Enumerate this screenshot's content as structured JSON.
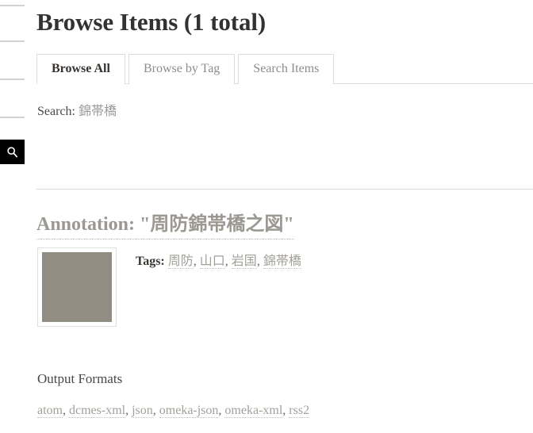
{
  "sidebar": {
    "nav_placeholder_count": 4,
    "search_button": {
      "icon": "search-icon",
      "label": "Search",
      "background": "#000000"
    }
  },
  "page": {
    "title": "Browse Items (1 total)"
  },
  "tabs": [
    {
      "label": "Browse All",
      "active": true
    },
    {
      "label": "Browse by Tag",
      "active": false
    },
    {
      "label": "Search Items",
      "active": false
    }
  ],
  "search_summary": {
    "label": "Search:",
    "query": "錦帯橋"
  },
  "record": {
    "heading": "Annotation: \"周防錦帯橋之図\"",
    "thumbnail": {
      "alt": "Annotation thumbnail",
      "placeholder_color": "#918d83"
    },
    "tags_label": "Tags:",
    "tags": [
      "周防",
      "山口",
      "岩国",
      "錦帯橋"
    ],
    "tag_separator": ", "
  },
  "output_formats": {
    "heading": "Output Formats",
    "formats": [
      "atom",
      "dcmes-xml",
      "json",
      "omeka-json",
      "omeka-xml",
      "rss2"
    ],
    "separator": ", "
  },
  "colors": {
    "title": "#333230",
    "link_gray": "#a3a09b",
    "rule": "#dcdcdc",
    "accent_black": "#000000"
  }
}
